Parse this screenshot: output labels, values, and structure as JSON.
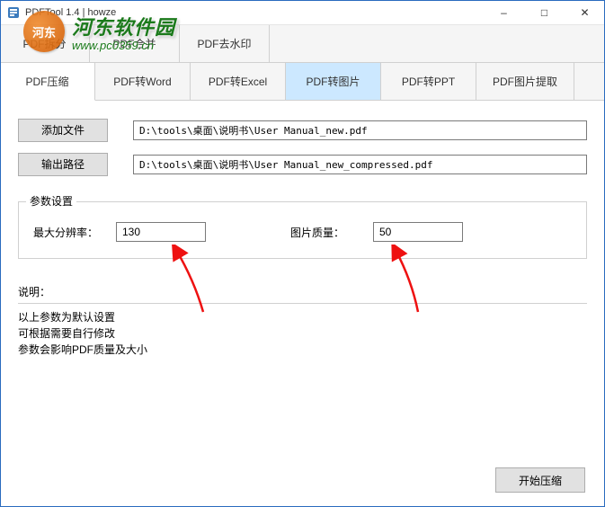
{
  "window": {
    "title": "PDFTool 1.4 | howze",
    "min_label": "–",
    "max_label": "□",
    "close_label": "✕"
  },
  "watermark": {
    "logo_text": "河东",
    "main": "河东软件园",
    "sub": "www.pc0359.cn"
  },
  "tabs_row1": [
    {
      "label": "PDF拆分"
    },
    {
      "label": "PDF合并"
    },
    {
      "label": "PDF去水印"
    }
  ],
  "tabs_row2": [
    {
      "label": "PDF压缩",
      "active": true
    },
    {
      "label": "PDF转Word"
    },
    {
      "label": "PDF转Excel"
    },
    {
      "label": "PDF转图片",
      "selected": true
    },
    {
      "label": "PDF转PPT"
    },
    {
      "label": "PDF图片提取"
    }
  ],
  "buttons": {
    "add_file": "添加文件",
    "output_path": "输出路径",
    "start": "开始压缩"
  },
  "paths": {
    "input": "D:\\tools\\桌面\\说明书\\User Manual_new.pdf",
    "output": "D:\\tools\\桌面\\说明书\\User Manual_new_compressed.pdf"
  },
  "params": {
    "legend": "参数设置",
    "max_res_label": "最大分辨率：",
    "max_res_value": "130",
    "quality_label": "图片质量：",
    "quality_value": "50"
  },
  "notes": {
    "title": "说明：",
    "line1": "以上参数为默认设置",
    "line2": "可根据需要自行修改",
    "line3": "参数会影响PDF质量及大小"
  }
}
